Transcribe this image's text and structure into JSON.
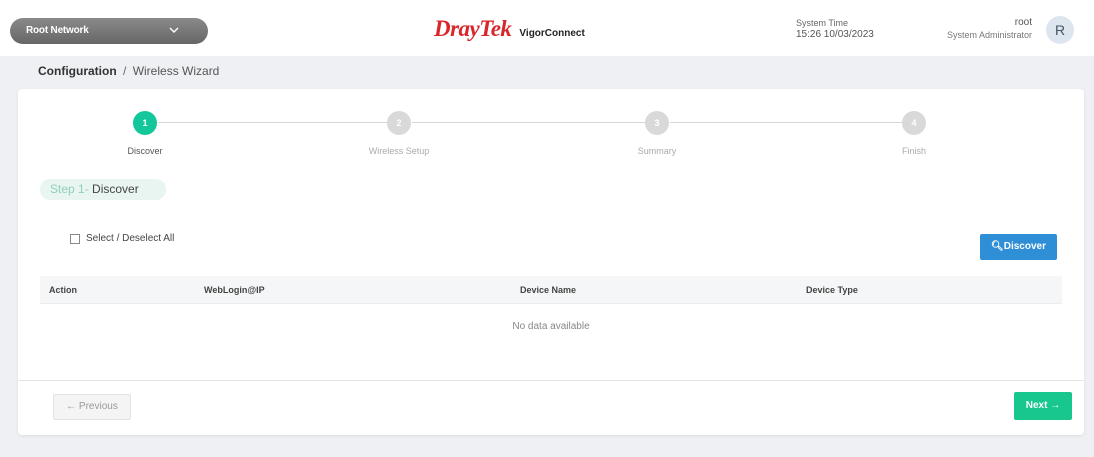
{
  "header": {
    "network_select": "Root Network",
    "brand": "DrayTek",
    "product": "VigorConnect",
    "system_time_label": "System Time",
    "system_time_value": "15:26 10/03/2023",
    "user_name": "root",
    "user_role": "System Administrator",
    "avatar_initial": "R"
  },
  "breadcrumb": {
    "root": "Configuration",
    "separator": "/",
    "current": "Wireless Wizard"
  },
  "wizard": {
    "steps": [
      {
        "number": "1",
        "label": "Discover",
        "active": true
      },
      {
        "number": "2",
        "label": "Wireless Setup",
        "active": false
      },
      {
        "number": "3",
        "label": "Summary",
        "active": false
      },
      {
        "number": "4",
        "label": "Finish",
        "active": false
      }
    ],
    "step_title_prefix": "Step 1",
    "step_title_sep": "-",
    "step_title": "Discover"
  },
  "controls": {
    "select_all_label": "Select / Deselect All",
    "discover_button": "Discover"
  },
  "table": {
    "columns": [
      "Action",
      "WebLogin@IP",
      "Device Name",
      "Device Type"
    ],
    "empty_text": "No data available"
  },
  "footer": {
    "previous_button": "← Previous",
    "next_button": "Next →"
  },
  "colors": {
    "accent_green": "#13c79b",
    "discover_blue": "#2f8fd6",
    "brand_red": "#d8262b"
  }
}
